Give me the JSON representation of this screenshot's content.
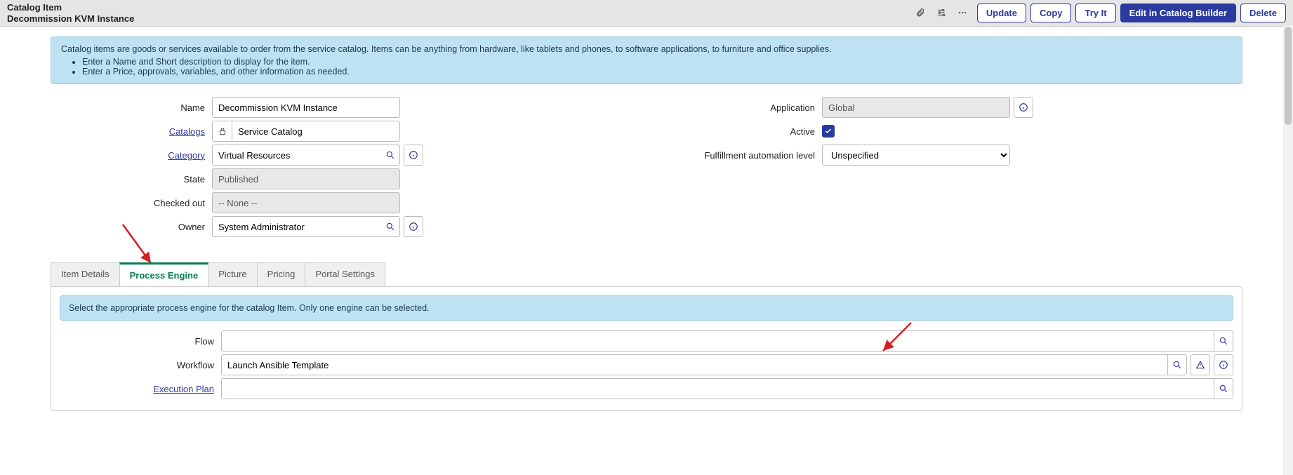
{
  "header": {
    "type_label": "Catalog Item",
    "record_title": "Decommission KVM Instance",
    "buttons": {
      "update": "Update",
      "copy": "Copy",
      "tryit": "Try It",
      "edit_builder": "Edit in Catalog Builder",
      "delete": "Delete"
    }
  },
  "info_box": {
    "text": "Catalog items are goods or services available to order from the service catalog. Items can be anything from hardware, like tablets and phones, to software applications, to furniture and office supplies.",
    "bullets": [
      "Enter a Name and Short description to display for the item.",
      "Enter a Price, approvals, variables, and other information as needed."
    ]
  },
  "form": {
    "labels": {
      "name": "Name",
      "catalogs": "Catalogs",
      "category": "Category",
      "state": "State",
      "checked_out": "Checked out",
      "owner": "Owner",
      "application": "Application",
      "active": "Active",
      "fal": "Fulfillment automation level"
    },
    "values": {
      "name": "Decommission KVM Instance",
      "catalogs": "Service Catalog",
      "category": "Virtual Resources",
      "state": "Published",
      "checked_out": "-- None --",
      "owner": "System Administrator",
      "application": "Global",
      "fal": "Unspecified"
    }
  },
  "tabs": {
    "items": [
      "Item Details",
      "Process Engine",
      "Picture",
      "Pricing",
      "Portal Settings"
    ],
    "active_index": 1
  },
  "process_engine": {
    "info": "Select the appropriate process engine for the catalog Item. Only one engine can be selected.",
    "labels": {
      "flow": "Flow",
      "workflow": "Workflow",
      "execution_plan": "Execution Plan"
    },
    "values": {
      "flow": "",
      "workflow": "Launch Ansible Template",
      "execution_plan": ""
    }
  },
  "colors": {
    "arrow": "#d22020"
  }
}
